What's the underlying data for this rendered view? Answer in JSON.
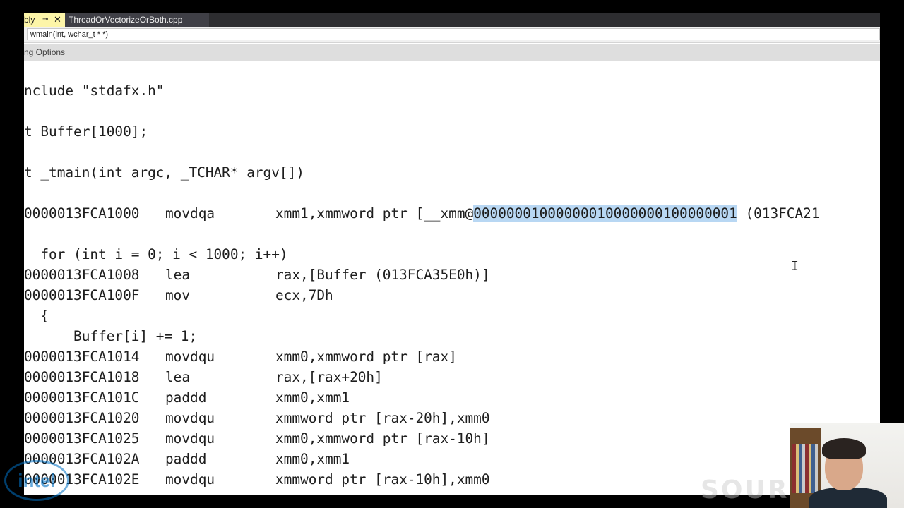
{
  "tabs": {
    "active_label": "bly",
    "pin_icon": "pin-icon",
    "close_icon": "close-icon",
    "document_label": "ThreadOrVectorizeOrBoth.cpp"
  },
  "navbar": {
    "function_combo": "wmain(int, wchar_t * *)"
  },
  "viewbar": {
    "label": "ng Options"
  },
  "code": {
    "include": "nclude \"stdafx.h\"",
    "buffer_decl": "t Buffer[1000];",
    "main_decl": "t _tmain(int argc, _TCHAR* argv[])",
    "for_line": "  for (int i = 0; i < 1000; i++)",
    "brace": "  {",
    "body_line": "      Buffer[i] += 1;",
    "asm": [
      {
        "addr": "0000013FCA1000",
        "op": "movdqa",
        "args_pre": "xmm1,xmmword ptr [__xmm@",
        "args_sel": "00000001000000010000000100000001",
        "args_post": " (013FCA21"
      },
      {
        "addr": "0000013FCA1008",
        "op": "lea",
        "args": "rax,[Buffer (013FCA35E0h)]"
      },
      {
        "addr": "0000013FCA100F",
        "op": "mov",
        "args": "ecx,7Dh"
      },
      {
        "addr": "0000013FCA1014",
        "op": "movdqu",
        "args": "xmm0,xmmword ptr [rax]"
      },
      {
        "addr": "0000013FCA1018",
        "op": "lea",
        "args": "rax,[rax+20h]"
      },
      {
        "addr": "0000013FCA101C",
        "op": "paddd",
        "args": "xmm0,xmm1"
      },
      {
        "addr": "0000013FCA1020",
        "op": "movdqu",
        "args": "xmmword ptr [rax-20h],xmm0"
      },
      {
        "addr": "0000013FCA1025",
        "op": "movdqu",
        "args": "xmm0,xmmword ptr [rax-10h]"
      },
      {
        "addr": "0000013FCA102A",
        "op": "paddd",
        "args": "xmm0,xmm1"
      },
      {
        "addr": "0000013FCA102E",
        "op": "movdqu",
        "args": "xmmword ptr [rax-10h],xmm0"
      }
    ]
  },
  "overlay": {
    "logo_text": "intel",
    "watermark_text": "SOURC"
  },
  "colors": {
    "selection": "#b8d7f3",
    "tab_active": "#fdf5a8",
    "tab_strip": "#2d2d30"
  }
}
